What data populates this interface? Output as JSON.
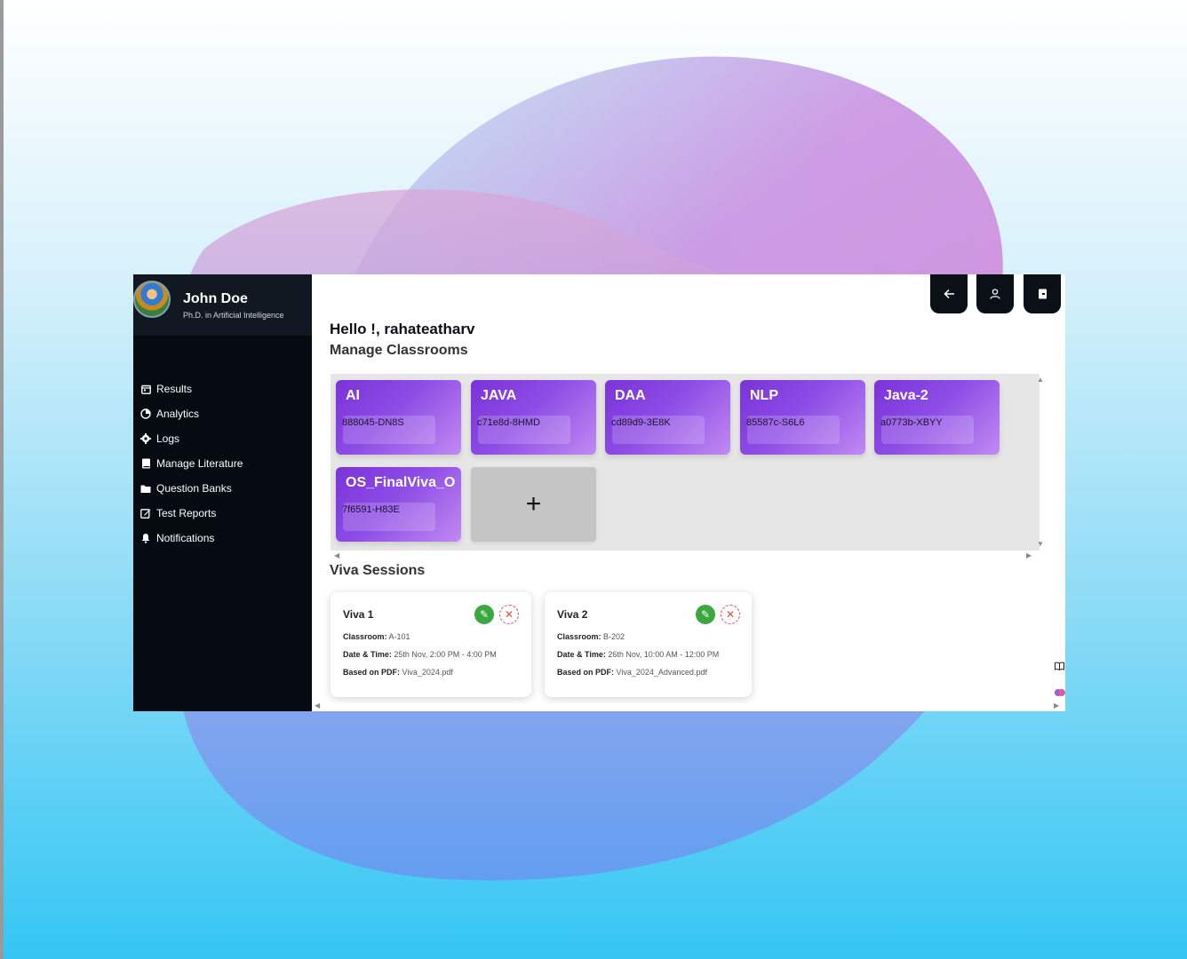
{
  "sidebar": {
    "profile": {
      "name": "John Doe",
      "subtitle": "Ph.D. in Artificial Intelligence"
    },
    "items": [
      {
        "label": "Results",
        "icon": "calendar-icon"
      },
      {
        "label": "Analytics",
        "icon": "analytics-icon"
      },
      {
        "label": "Logs",
        "icon": "gear-icon"
      },
      {
        "label": "Manage Literature",
        "icon": "book-icon"
      },
      {
        "label": "Question Banks",
        "icon": "folder-icon"
      },
      {
        "label": "Test Reports",
        "icon": "edit-icon"
      },
      {
        "label": "Notifications",
        "icon": "bell-icon"
      }
    ]
  },
  "header": {
    "greeting": "Hello !, rahateatharv",
    "buttons": [
      "back-arrow-icon",
      "user-icon",
      "logout-icon"
    ]
  },
  "classrooms": {
    "title": "Manage Classrooms",
    "items": [
      {
        "name": "AI",
        "code": "888045-DN8S"
      },
      {
        "name": "JAVA",
        "code": "c71e8d-8HMD"
      },
      {
        "name": "DAA",
        "code": "cd89d9-3E8K"
      },
      {
        "name": "NLP",
        "code": "85587c-S6L6"
      },
      {
        "name": "Java-2",
        "code": "a0773b-XBYY"
      },
      {
        "name": "OS_FinalViva_O",
        "code": "7f6591-H83E"
      }
    ],
    "add_label": "+"
  },
  "viva": {
    "title": "Viva Sessions",
    "items": [
      {
        "title": "Viva 1",
        "classroom_label": "Classroom:",
        "classroom": "A-101",
        "datetime_label": "Date & Time:",
        "datetime": "25th Nov, 2:00 PM - 4:00 PM",
        "pdf_label": "Based on PDF:",
        "pdf": "Viva_2024.pdf"
      },
      {
        "title": "Viva 2",
        "classroom_label": "Classroom:",
        "classroom": "B-202",
        "datetime_label": "Date & Time:",
        "datetime": "26th Nov, 10:00 AM - 12:00 PM",
        "pdf_label": "Based on PDF:",
        "pdf": "Viva_2024_Advanced.pdf"
      }
    ]
  },
  "colors": {
    "sidebar_bg": "#060b12",
    "card_purple": "#8d4ce6",
    "edit_green": "#3aa83f",
    "delete_red": "#e34a4a"
  }
}
